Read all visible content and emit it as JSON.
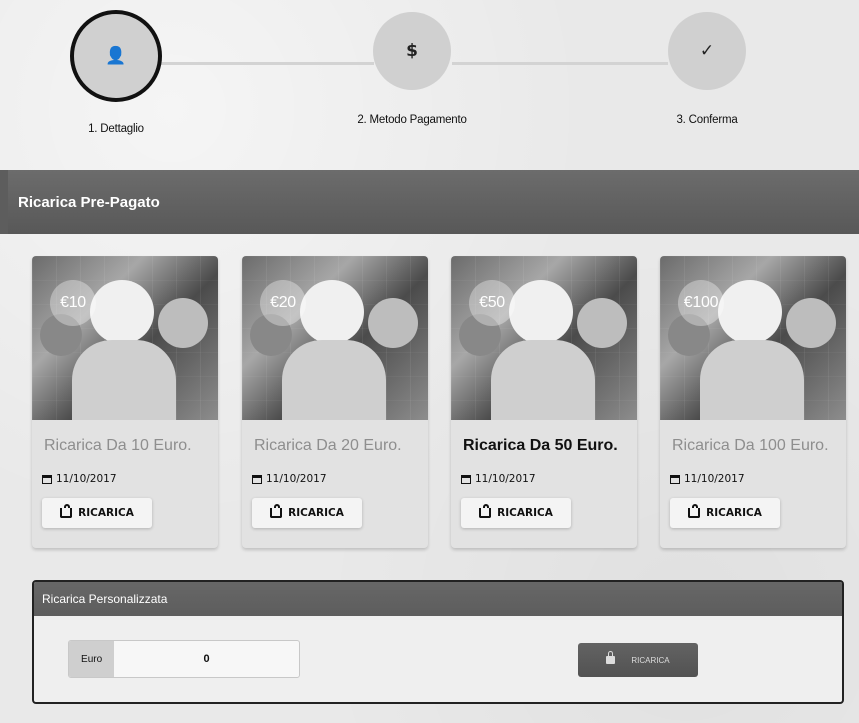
{
  "wizard": {
    "steps": [
      {
        "label": "1. Dettaglio",
        "icon": "user-icon",
        "icon_text": "👤",
        "state": "active"
      },
      {
        "label": "2. Metodo Pagamento",
        "icon": "dollar-icon",
        "icon_text": "$",
        "state": "inactive"
      },
      {
        "label": "3. Conferma",
        "icon": "check-icon",
        "icon_text": "✓",
        "state": "inactive"
      }
    ]
  },
  "section": {
    "title": "Ricarica Pre-Pagato"
  },
  "cards": [
    {
      "price": "€10",
      "title": "Ricarica Da 10 Euro.",
      "date": "11/10/2017",
      "button": "RICARICA",
      "title_style": "muted"
    },
    {
      "price": "€20",
      "title": "Ricarica Da 20 Euro.",
      "date": "11/10/2017",
      "button": "RICARICA",
      "title_style": "muted"
    },
    {
      "price": "€50",
      "title": "Ricarica Da 50 Euro.",
      "date": "11/10/2017",
      "button": "RICARICA",
      "title_style": "dark"
    },
    {
      "price": "€100",
      "title": "Ricarica Da 100 Euro.",
      "date": "11/10/2017",
      "button": "RICARICA",
      "title_style": "muted"
    }
  ],
  "custom": {
    "title": "Ricarica Personalizzata",
    "input_label": "Euro",
    "input_value": "0",
    "button": "RICARICA"
  },
  "colors": {
    "background": "#e9e9e9",
    "header": "#5f5f5f",
    "card": "#e2e2e2",
    "step_inactive": "#d0d0d0"
  }
}
